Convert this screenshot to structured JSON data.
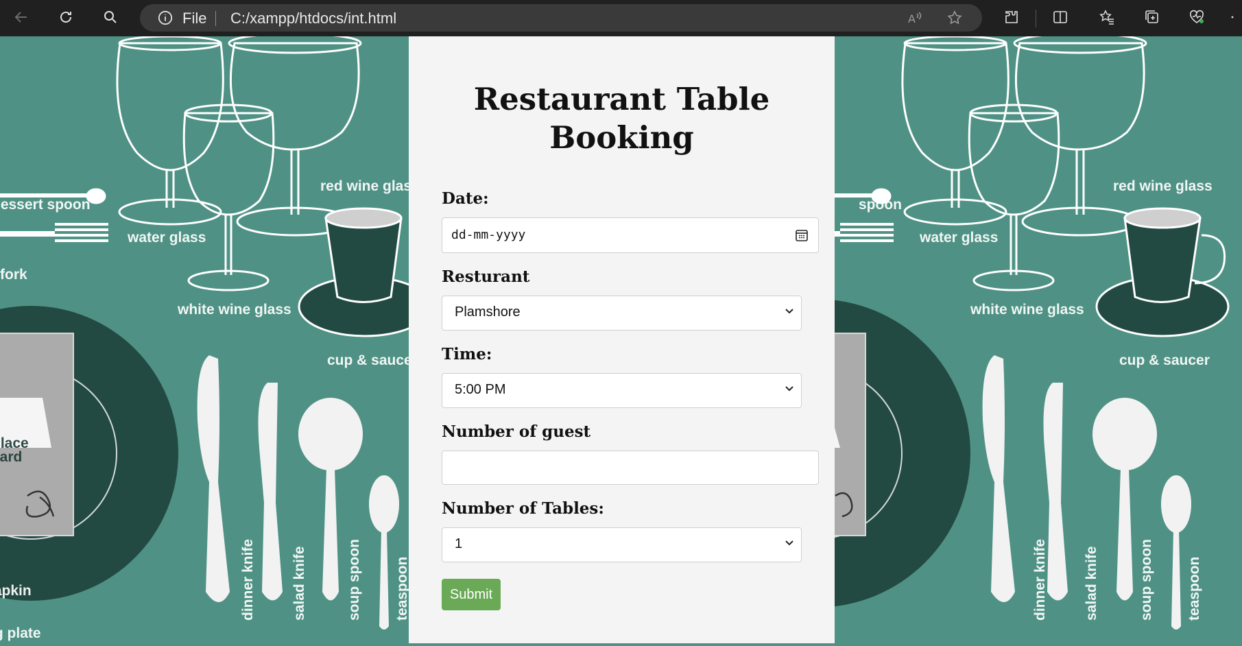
{
  "browser": {
    "file_label": "File",
    "url": "C:/xampp/htdocs/int.html"
  },
  "background": {
    "labels": {
      "dessert_spoon": "dessert spoon",
      "dessert_spoon_r": "spoon",
      "red_wine_glass": "red wine glass",
      "water_glass": "water glass",
      "fork": "fork",
      "white_wine_glass": "white wine glass",
      "cup_saucer": "cup & saucer",
      "place_card_1": "place",
      "place_card_2": "card",
      "napkin": "napkin",
      "serving_plate": "serving plate",
      "dinner_knife": "dinner knife",
      "salad_knife": "salad knife",
      "soup_spoon": "soup spoon",
      "teaspoon": "teaspoon"
    }
  },
  "form": {
    "title": "Restaurant Table Booking",
    "date_label": "Date:",
    "date_placeholder": "dd-mm-yyyy",
    "restaurant_label": "Resturant",
    "restaurant_value": "Plamshore",
    "time_label": "Time:",
    "time_value": "5:00 PM",
    "guests_label": "Number of guest",
    "guests_value": "",
    "tables_label": "Number of Tables:",
    "tables_value": "1",
    "submit_label": "Submit"
  },
  "colors": {
    "accent_submit": "#6aaa57",
    "placemat_teal": "#4f9285",
    "plate_dark": "#234a42"
  }
}
